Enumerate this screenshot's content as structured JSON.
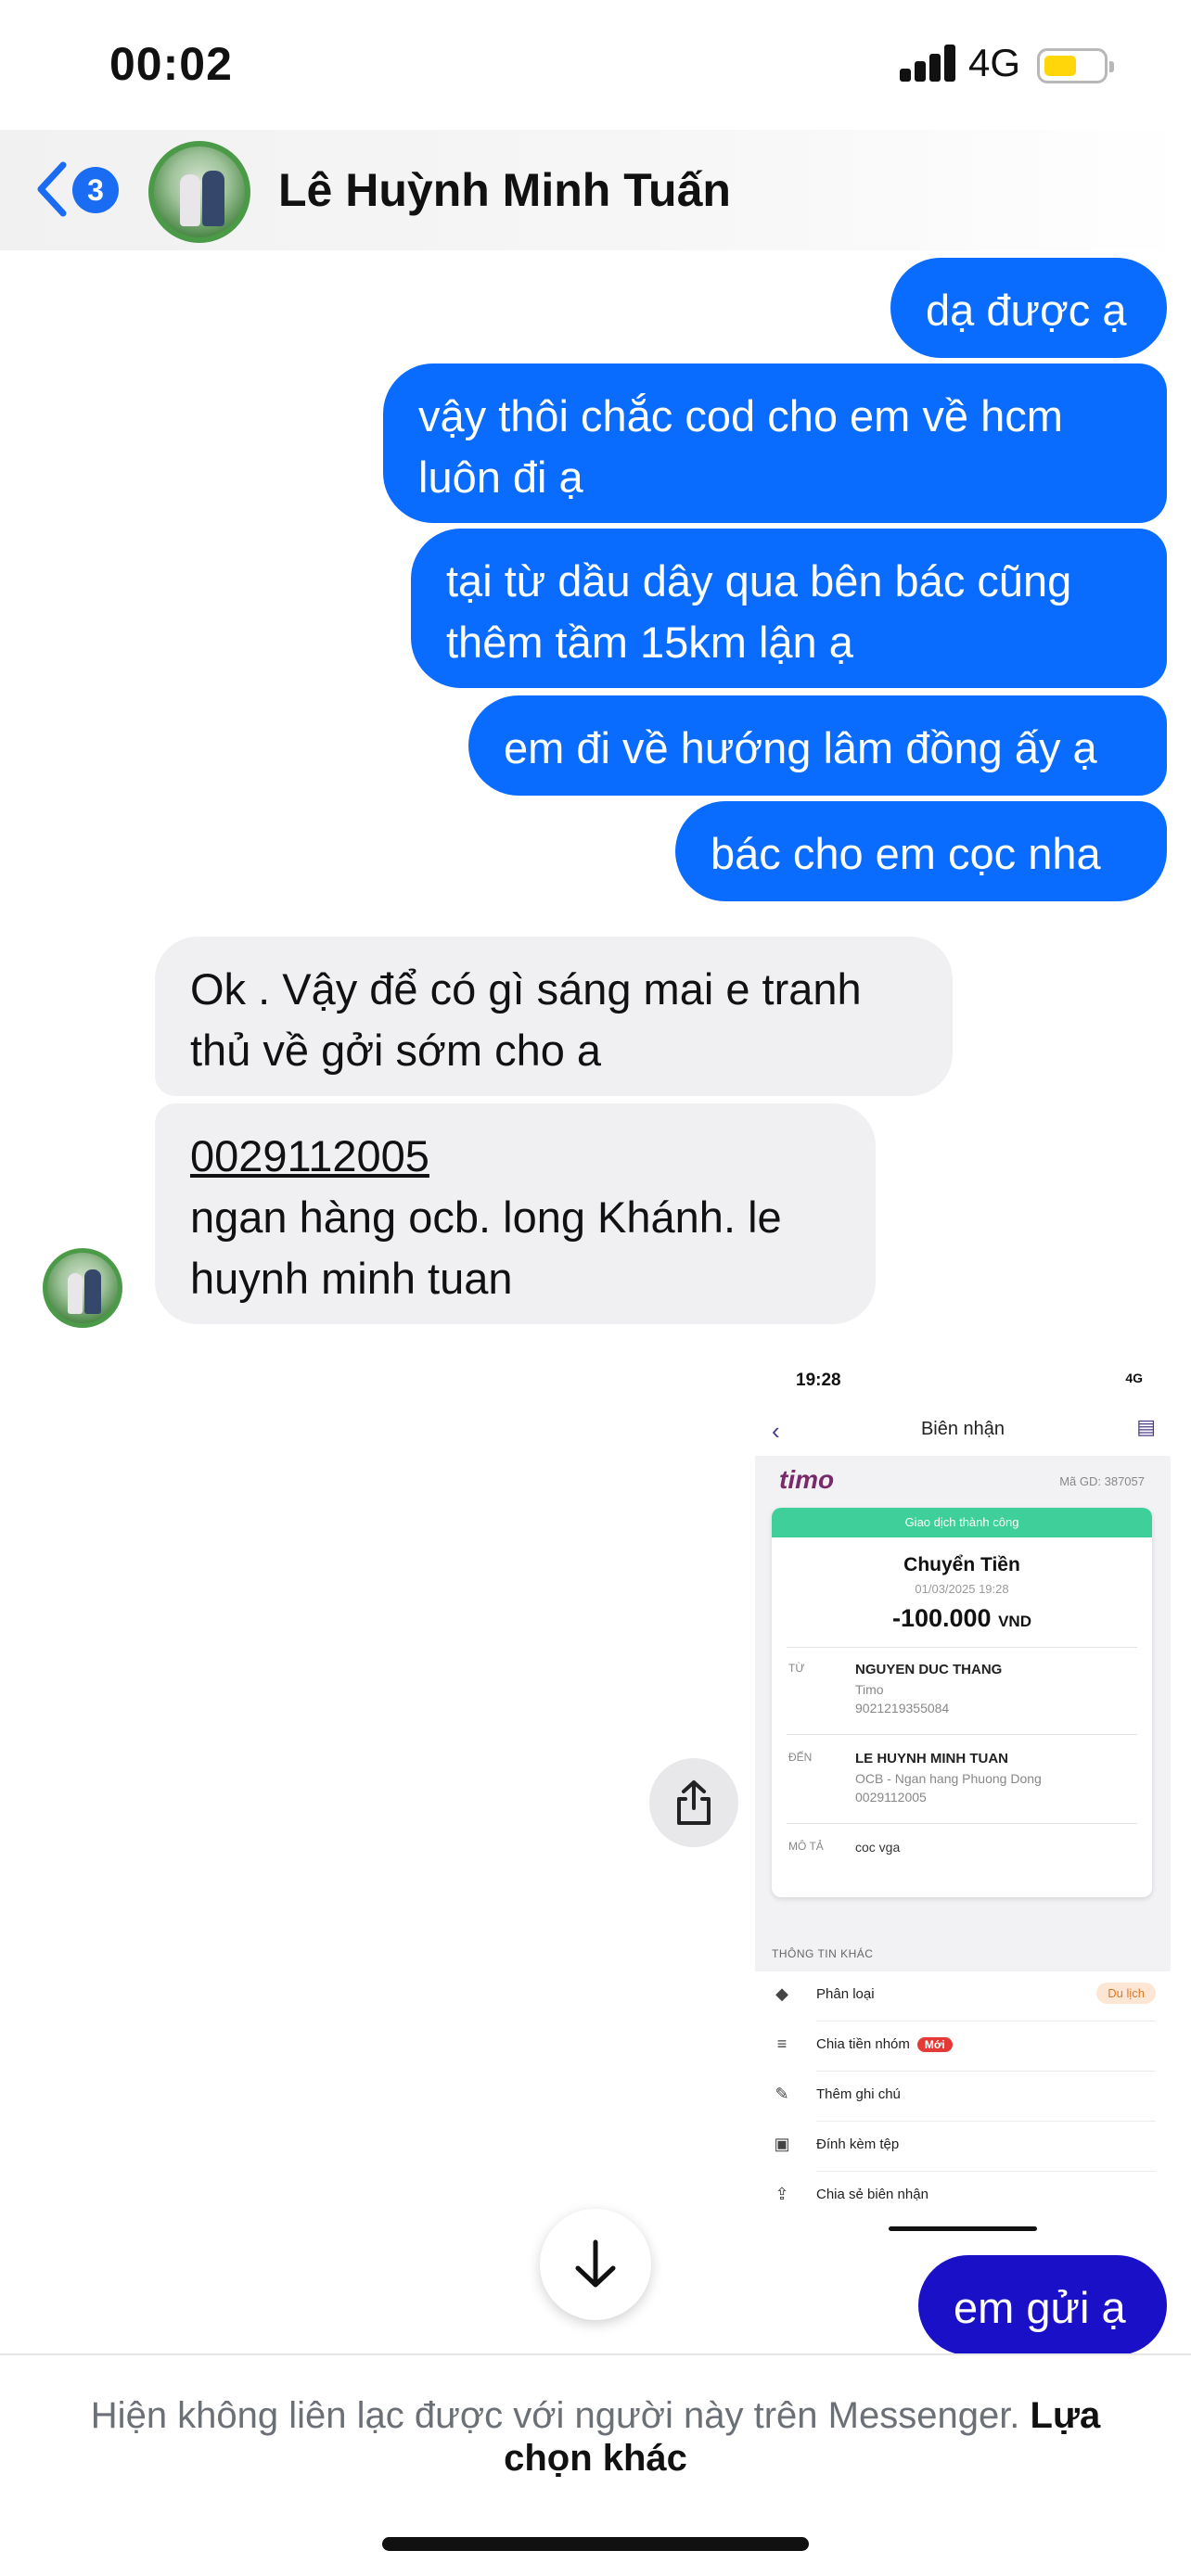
{
  "status_bar": {
    "time": "00:02",
    "network": "4G"
  },
  "header": {
    "back_badge": "3",
    "contact_name": "Lê Huỳnh Minh Tuấn"
  },
  "messages": [
    {
      "side": "out",
      "text": "dạ được ạ"
    },
    {
      "side": "out",
      "text": "vậy thôi chắc cod cho em về hcm luôn đi ạ"
    },
    {
      "side": "out",
      "text": "tại từ dầu dây qua bên bác cũng thêm tầm 15km lận ạ"
    },
    {
      "side": "out",
      "text": "em đi về hướng lâm đồng ấy ạ"
    },
    {
      "side": "out",
      "text": "bác cho em cọc nha"
    },
    {
      "side": "in",
      "text": "Ok . Vậy để có gì sáng mai e tranh thủ về gởi sớm cho a"
    },
    {
      "side": "in",
      "account_number": "0029112005",
      "text": "ngan hàng ocb. long Khánh. le huynh minh tuan"
    },
    {
      "side": "out",
      "text": "em gửi ạ"
    }
  ],
  "receipt": {
    "time": "19:28",
    "network": "4G",
    "title": "Biên nhận",
    "logo": "timo",
    "transaction_code": "Mã GD: 387057",
    "success_text": "Giao dịch thành công",
    "kind": "Chuyển Tiền",
    "date": "01/03/2025 19:28",
    "amount": "-100.000",
    "currency": "VND",
    "from_label": "TỪ",
    "from_name": "NGUYEN DUC THANG",
    "from_bank": "Timo",
    "from_account": "9021219355084",
    "to_label": "ĐẾN",
    "to_name": "LE HUYNH MINH TUAN",
    "to_bank": "OCB - Ngan hang Phuong Dong",
    "to_account": "0029112005",
    "desc_label": "MÔ TẢ",
    "desc": "coc vga",
    "other_info": "THÔNG TIN KHÁC",
    "rows": [
      {
        "label": "Phân loại",
        "tag": "Du lịch"
      },
      {
        "label": "Chia tiền nhóm",
        "badge": "Mới"
      },
      {
        "label": "Thêm ghi chú"
      },
      {
        "label": "Đính kèm tệp"
      },
      {
        "label": "Chia sẻ biên nhận"
      }
    ]
  },
  "footer": {
    "notice": "Hiện không liên lạc được với người này trên Messenger.",
    "link": "Lựa chọn khác"
  },
  "colors": {
    "outgoing": "#0a6cff",
    "outgoing_last": "#1a10c8",
    "incoming": "#f0f0f3",
    "badge": "#1a6cf2"
  }
}
